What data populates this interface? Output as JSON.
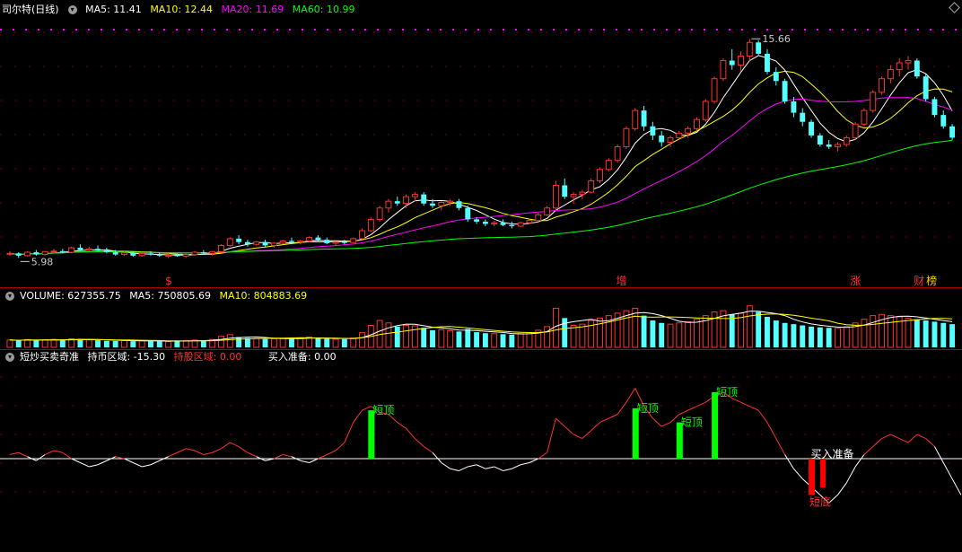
{
  "header": {
    "title": "司尔特(日线)",
    "ma5": "MA5: 11.41",
    "ma10": "MA10: 12.44",
    "ma20": "MA20: 11.69",
    "ma60": "MA60: 10.99",
    "colors": {
      "ma5": "#ffffff",
      "ma10": "#ffff00",
      "ma20": "#ff00ff",
      "ma60": "#00ff00"
    }
  },
  "volume_header": {
    "label": "VOLUME: 627355.75",
    "ma5": "MA5: 750805.69",
    "ma10": "MA10: 804883.69"
  },
  "indicator_header": {
    "name": "短炒买卖奇准",
    "market": "持币区域: -15.30",
    "hold": "持股区域: 0.00",
    "buy": "买入准备: 0.00"
  },
  "chart_data": {
    "type": "candlestick",
    "price_high_label": "15.66",
    "price_low_label": "5.98",
    "event_markers": [
      "$",
      "增",
      "涨",
      "财",
      "榜"
    ],
    "price_range": [
      5.5,
      16.5
    ],
    "candles": [
      [
        6.2,
        6.3,
        6.1,
        6.2
      ],
      [
        6.2,
        6.25,
        6.0,
        6.1
      ],
      [
        6.1,
        6.3,
        6.05,
        6.25
      ],
      [
        6.25,
        6.35,
        6.1,
        6.15
      ],
      [
        6.15,
        6.3,
        6.1,
        6.28
      ],
      [
        6.28,
        6.4,
        6.2,
        6.3
      ],
      [
        6.3,
        6.4,
        6.2,
        6.25
      ],
      [
        6.25,
        6.5,
        6.2,
        6.45
      ],
      [
        6.45,
        6.6,
        6.3,
        6.35
      ],
      [
        6.35,
        6.5,
        6.3,
        6.4
      ],
      [
        6.4,
        6.55,
        6.3,
        6.32
      ],
      [
        6.32,
        6.45,
        6.2,
        6.25
      ],
      [
        6.25,
        6.35,
        6.1,
        6.15
      ],
      [
        6.15,
        6.3,
        6.1,
        6.22
      ],
      [
        6.22,
        6.3,
        6.05,
        6.1
      ],
      [
        6.1,
        6.25,
        6.05,
        6.2
      ],
      [
        6.2,
        6.3,
        6.1,
        6.15
      ],
      [
        6.15,
        6.25,
        6.05,
        6.1
      ],
      [
        6.1,
        6.2,
        6.0,
        6.12
      ],
      [
        6.12,
        6.2,
        6.05,
        6.08
      ],
      [
        6.08,
        6.2,
        6.0,
        6.15
      ],
      [
        6.15,
        6.3,
        6.1,
        6.25
      ],
      [
        6.25,
        6.35,
        6.15,
        6.2
      ],
      [
        6.2,
        6.3,
        6.1,
        6.28
      ],
      [
        6.28,
        6.6,
        6.25,
        6.55
      ],
      [
        6.55,
        6.9,
        6.5,
        6.85
      ],
      [
        6.85,
        7.0,
        6.6,
        6.7
      ],
      [
        6.7,
        6.8,
        6.5,
        6.6
      ],
      [
        6.6,
        6.75,
        6.55,
        6.7
      ],
      [
        6.7,
        6.8,
        6.5,
        6.55
      ],
      [
        6.55,
        6.7,
        6.45,
        6.65
      ],
      [
        6.65,
        6.8,
        6.6,
        6.75
      ],
      [
        6.75,
        6.9,
        6.6,
        6.7
      ],
      [
        6.7,
        6.8,
        6.6,
        6.75
      ],
      [
        6.75,
        6.95,
        6.7,
        6.9
      ],
      [
        6.9,
        7.0,
        6.7,
        6.8
      ],
      [
        6.8,
        6.9,
        6.6,
        6.65
      ],
      [
        6.65,
        6.75,
        6.55,
        6.7
      ],
      [
        6.7,
        6.8,
        6.6,
        6.68
      ],
      [
        6.68,
        6.9,
        6.65,
        6.85
      ],
      [
        6.85,
        7.3,
        6.8,
        7.2
      ],
      [
        7.2,
        7.8,
        7.15,
        7.7
      ],
      [
        7.7,
        8.3,
        7.6,
        8.2
      ],
      [
        8.2,
        8.6,
        8.0,
        8.5
      ],
      [
        8.5,
        8.7,
        8.3,
        8.4
      ],
      [
        8.4,
        8.8,
        8.2,
        8.7
      ],
      [
        8.7,
        8.9,
        8.5,
        8.8
      ],
      [
        8.8,
        8.9,
        8.3,
        8.4
      ],
      [
        8.4,
        8.6,
        8.2,
        8.3
      ],
      [
        8.3,
        8.5,
        8.1,
        8.45
      ],
      [
        8.45,
        8.6,
        8.3,
        8.5
      ],
      [
        8.5,
        8.6,
        8.1,
        8.2
      ],
      [
        8.2,
        8.3,
        7.6,
        7.7
      ],
      [
        7.7,
        7.8,
        7.5,
        7.6
      ],
      [
        7.6,
        7.7,
        7.4,
        7.5
      ],
      [
        7.5,
        7.65,
        7.4,
        7.55
      ],
      [
        7.55,
        7.7,
        7.4,
        7.45
      ],
      [
        7.45,
        7.6,
        7.3,
        7.4
      ],
      [
        7.4,
        7.6,
        7.35,
        7.55
      ],
      [
        7.55,
        7.7,
        7.5,
        7.65
      ],
      [
        7.65,
        8.0,
        7.6,
        7.9
      ],
      [
        7.9,
        8.3,
        7.85,
        8.2
      ],
      [
        8.2,
        9.4,
        8.1,
        9.2
      ],
      [
        9.2,
        9.5,
        8.6,
        8.7
      ],
      [
        8.7,
        8.9,
        8.4,
        8.8
      ],
      [
        8.8,
        9.0,
        8.6,
        8.9
      ],
      [
        8.9,
        9.5,
        8.85,
        9.4
      ],
      [
        9.4,
        10.0,
        9.3,
        9.9
      ],
      [
        9.9,
        10.4,
        9.8,
        10.3
      ],
      [
        10.3,
        11.0,
        10.2,
        10.9
      ],
      [
        10.9,
        11.8,
        10.8,
        11.7
      ],
      [
        11.7,
        12.6,
        11.6,
        12.5
      ],
      [
        12.5,
        12.7,
        11.6,
        11.8
      ],
      [
        11.8,
        12.0,
        11.2,
        11.4
      ],
      [
        11.4,
        11.6,
        10.9,
        11.1
      ],
      [
        11.1,
        11.4,
        10.9,
        11.3
      ],
      [
        11.3,
        11.6,
        11.2,
        11.5
      ],
      [
        11.5,
        11.8,
        11.3,
        11.7
      ],
      [
        11.7,
        12.2,
        11.6,
        12.1
      ],
      [
        12.1,
        13.0,
        12.0,
        12.9
      ],
      [
        12.9,
        14.0,
        12.8,
        13.9
      ],
      [
        13.9,
        14.8,
        13.8,
        14.7
      ],
      [
        14.7,
        15.2,
        14.3,
        14.5
      ],
      [
        14.5,
        15.1,
        14.2,
        14.9
      ],
      [
        14.9,
        15.66,
        14.7,
        15.5
      ],
      [
        15.5,
        15.6,
        14.9,
        15.0
      ],
      [
        15.0,
        15.2,
        14.1,
        14.2
      ],
      [
        14.2,
        14.4,
        13.6,
        13.8
      ],
      [
        13.8,
        13.9,
        12.8,
        12.9
      ],
      [
        12.9,
        13.1,
        12.2,
        12.4
      ],
      [
        12.4,
        12.6,
        11.8,
        12.0
      ],
      [
        12.0,
        12.1,
        11.3,
        11.4
      ],
      [
        11.4,
        11.5,
        10.9,
        11.0
      ],
      [
        11.0,
        11.2,
        10.8,
        10.9
      ],
      [
        10.9,
        11.1,
        10.7,
        11.0
      ],
      [
        11.0,
        11.4,
        10.9,
        11.3
      ],
      [
        11.3,
        12.0,
        11.2,
        11.9
      ],
      [
        11.9,
        12.6,
        11.8,
        12.5
      ],
      [
        12.5,
        13.4,
        12.4,
        13.3
      ],
      [
        13.3,
        14.0,
        13.2,
        13.9
      ],
      [
        13.9,
        14.5,
        13.7,
        14.3
      ],
      [
        14.3,
        14.8,
        14.0,
        14.6
      ],
      [
        14.6,
        14.9,
        14.3,
        14.7
      ],
      [
        14.7,
        14.8,
        13.9,
        14.0
      ],
      [
        14.0,
        14.1,
        12.9,
        13.0
      ],
      [
        13.0,
        13.1,
        12.2,
        12.3
      ],
      [
        12.3,
        12.5,
        11.7,
        11.8
      ],
      [
        11.8,
        11.9,
        11.2,
        11.3
      ]
    ],
    "volume_range": [
      0,
      1800000
    ],
    "volumes": [
      300000,
      280000,
      320000,
      290000,
      310000,
      330000,
      300000,
      350000,
      340000,
      310000,
      290000,
      270000,
      260000,
      280000,
      250000,
      270000,
      260000,
      250000,
      240000,
      260000,
      280000,
      300000,
      290000,
      320000,
      450000,
      520000,
      420000,
      380000,
      360000,
      340000,
      350000,
      370000,
      360000,
      380000,
      420000,
      400000,
      350000,
      330000,
      340000,
      380000,
      600000,
      900000,
      1100000,
      1000000,
      850000,
      900000,
      880000,
      800000,
      700000,
      720000,
      680000,
      650000,
      750000,
      620000,
      580000,
      560000,
      540000,
      520000,
      560000,
      600000,
      700000,
      850000,
      1600000,
      1200000,
      900000,
      950000,
      1100000,
      1200000,
      1300000,
      1400000,
      1500000,
      1600000,
      1300000,
      1100000,
      1000000,
      950000,
      1000000,
      1050000,
      1150000,
      1300000,
      1450000,
      1500000,
      1350000,
      1400000,
      1700000,
      1450000,
      1250000,
      1100000,
      1000000,
      950000,
      900000,
      850000,
      820000,
      800000,
      780000,
      850000,
      1000000,
      1150000,
      1300000,
      1350000,
      1300000,
      1250000,
      1200000,
      1150000,
      1100000,
      1050000,
      1000000,
      950000
    ],
    "indicator_range": [
      -45,
      45
    ],
    "indicator_line": [
      2,
      3,
      1,
      -1,
      2,
      4,
      3,
      0,
      -2,
      -4,
      -3,
      -1,
      1,
      0,
      -2,
      -4,
      -3,
      -1,
      1,
      3,
      5,
      4,
      2,
      3,
      5,
      8,
      6,
      3,
      1,
      -1,
      0,
      2,
      1,
      -1,
      -2,
      0,
      2,
      4,
      8,
      18,
      24,
      26,
      23,
      22,
      18,
      15,
      10,
      6,
      3,
      -2,
      -5,
      -6,
      -4,
      -3,
      -5,
      -4,
      -6,
      -5,
      -3,
      -2,
      0,
      3,
      20,
      16,
      12,
      10,
      14,
      18,
      20,
      22,
      28,
      35,
      26,
      20,
      16,
      18,
      22,
      24,
      26,
      28,
      31,
      33,
      30,
      28,
      26,
      24,
      18,
      10,
      2,
      -5,
      -10,
      -14,
      -18,
      -22,
      -18,
      -12,
      -4,
      2,
      6,
      10,
      12,
      10,
      8,
      12,
      10,
      6,
      -2,
      -10,
      -18
    ],
    "indicator_signals": [
      {
        "label": "短顶",
        "index": 41,
        "value": 24
      },
      {
        "label": "短顶",
        "index": 71,
        "value": 25
      },
      {
        "label": "短顶",
        "index": 76,
        "value": 18
      },
      {
        "label": "短顶",
        "index": 80,
        "value": 33
      },
      {
        "label": "短底",
        "index": 91,
        "value": -18
      },
      {
        "label": "买入准备",
        "index": 94,
        "value": 0
      }
    ]
  }
}
